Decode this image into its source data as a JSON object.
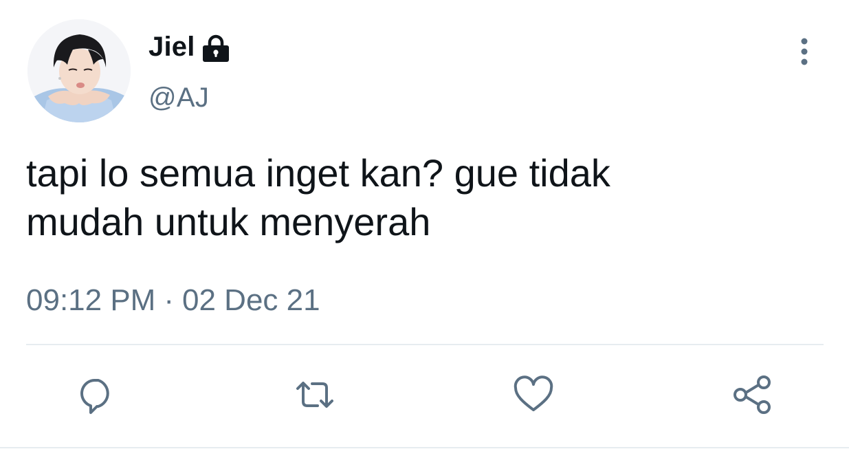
{
  "tweet": {
    "display_name": "Jiel",
    "handle": "@AJ",
    "text": "tapi lo semua inget kan? gue tidak\nmudah untuk menyerah",
    "time": "09:12 PM",
    "separator": "·",
    "date": "02 Dec 21",
    "avatar": "profile-photo",
    "protected_icon": "lock-icon"
  },
  "actions": [
    {
      "name": "reply",
      "icon": "reply-icon"
    },
    {
      "name": "retweet",
      "icon": "retweet-icon"
    },
    {
      "name": "like",
      "icon": "heart-icon"
    },
    {
      "name": "share",
      "icon": "share-icon"
    }
  ],
  "menu": {
    "icon": "more-vertical-icon"
  },
  "colors": {
    "text_primary": "#0f1419",
    "text_secondary": "#5b7083",
    "divider": "#e6ecf0",
    "icon": "#5b7083"
  }
}
